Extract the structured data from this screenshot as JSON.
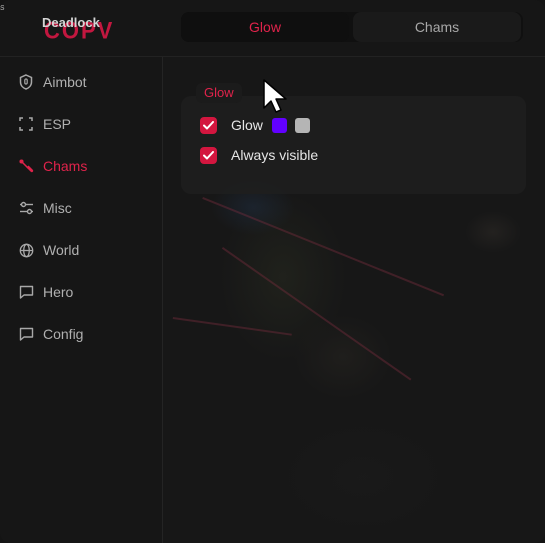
{
  "window": {
    "title": ""
  },
  "logo": {
    "back_text": "COPV",
    "front_text": "Deadlock"
  },
  "corner_mark": "s",
  "tabs": [
    {
      "label": "Glow",
      "active": true
    },
    {
      "label": "Chams",
      "active": false
    }
  ],
  "sidebar": {
    "items": [
      {
        "label": "Aimbot",
        "icon": "shield-icon",
        "active": false
      },
      {
        "label": "ESP",
        "icon": "scan-icon",
        "active": false
      },
      {
        "label": "Chams",
        "icon": "brush-icon",
        "active": true
      },
      {
        "label": "Misc",
        "icon": "sliders-icon",
        "active": false
      },
      {
        "label": "World",
        "icon": "globe-icon",
        "active": false
      },
      {
        "label": "Hero",
        "icon": "chat-icon",
        "active": false
      },
      {
        "label": "Config",
        "icon": "chat-icon",
        "active": false
      }
    ]
  },
  "glow_section": {
    "title": "Glow",
    "options": [
      {
        "label": "Glow",
        "checked": true,
        "colors": [
          "#6200ff",
          "#b5b5b5"
        ]
      },
      {
        "label": "Always visible",
        "checked": true
      }
    ]
  },
  "colors": {
    "accent": "#e0234b",
    "checkbox": "#d3163f"
  }
}
